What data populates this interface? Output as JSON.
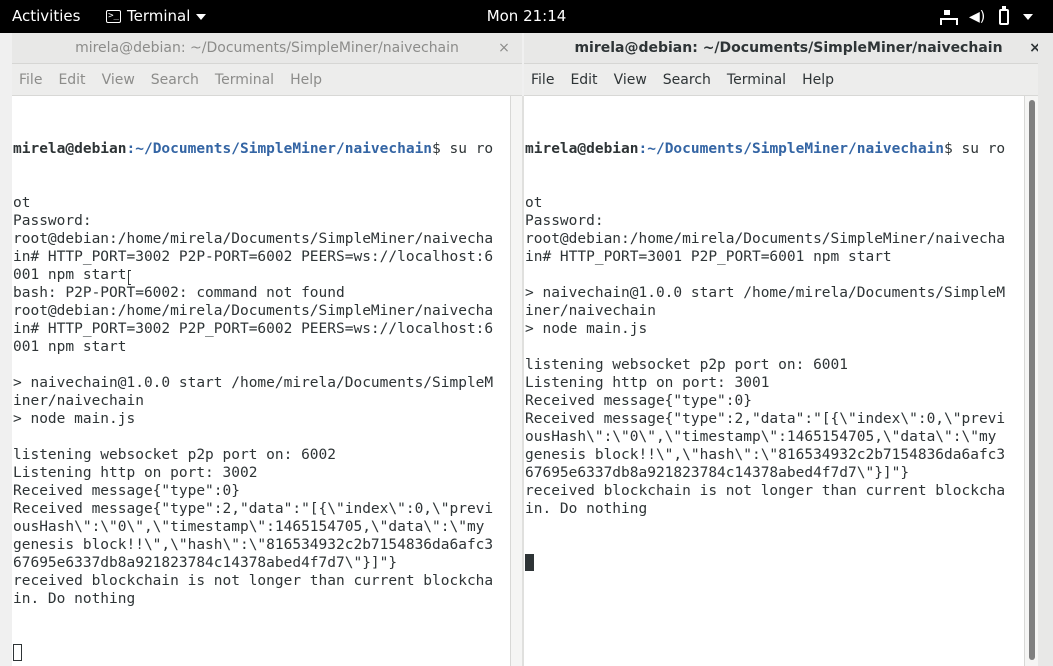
{
  "topbar": {
    "activities": "Activities",
    "app_name": "Terminal",
    "clock": "Mon 21:14",
    "icons": [
      "network-icon",
      "volume-icon",
      "battery-icon",
      "system-menu-caret-icon"
    ]
  },
  "left_window": {
    "title": "mirela@debian: ~/Documents/SimpleMiner/naivechain",
    "close": "×",
    "menu": [
      "File",
      "Edit",
      "View",
      "Search",
      "Terminal",
      "Help"
    ],
    "prompt_user": "mirela@debian",
    "prompt_path": ":~/Documents/SimpleMiner/naivechain",
    "first_cmd": "$ su ro",
    "lines": [
      "ot",
      "Password:",
      "root@debian:/home/mirela/Documents/SimpleMiner/naivecha",
      "in# HTTP_PORT=3002 P2P-PORT=6002 PEERS=ws://localhost:6",
      "001 npm start",
      "bash: P2P-PORT=6002: command not found",
      "root@debian:/home/mirela/Documents/SimpleMiner/naivecha",
      "in# HTTP_PORT=3002 P2P_PORT=6002 PEERS=ws://localhost:6",
      "001 npm start",
      "",
      "> naivechain@1.0.0 start /home/mirela/Documents/SimpleM",
      "iner/naivechain",
      "> node main.js",
      "",
      "listening websocket p2p port on: 6002",
      "Listening http on port: 3002",
      "Received message{\"type\":0}",
      "Received message{\"type\":2,\"data\":\"[{\\\"index\\\":0,\\\"previ",
      "ousHash\\\":\\\"0\\\",\\\"timestamp\\\":1465154705,\\\"data\\\":\\\"my",
      "genesis block!!\\\",\\\"hash\\\":\\\"816534932c2b7154836da6afc3",
      "67695e6337db8a921823784c14378abed4f7d7\\\"}]\"}",
      "received blockchain is not longer than current blockcha",
      "in. Do nothing"
    ]
  },
  "right_window": {
    "title": "mirela@debian: ~/Documents/SimpleMiner/naivechain",
    "close": "×",
    "menu": [
      "File",
      "Edit",
      "View",
      "Search",
      "Terminal",
      "Help"
    ],
    "prompt_user": "mirela@debian",
    "prompt_path": ":~/Documents/SimpleMiner/naivechain",
    "first_cmd": "$ su ro",
    "lines": [
      "ot",
      "Password:",
      "root@debian:/home/mirela/Documents/SimpleMiner/naivecha",
      "in# HTTP_PORT=3001 P2P_PORT=6001 npm start",
      "",
      "> naivechain@1.0.0 start /home/mirela/Documents/SimpleM",
      "iner/naivechain",
      "> node main.js",
      "",
      "listening websocket p2p port on: 6001",
      "Listening http on port: 3001",
      "Received message{\"type\":0}",
      "Received message{\"type\":2,\"data\":\"[{\\\"index\\\":0,\\\"previ",
      "ousHash\\\":\\\"0\\\",\\\"timestamp\\\":1465154705,\\\"data\\\":\\\"my",
      "genesis block!!\\\",\\\"hash\\\":\\\"816534932c2b7154836da6afc3",
      "67695e6337db8a921823784c14378abed4f7d7\\\"}]\"}",
      "received blockchain is not longer than current blockcha",
      "in. Do nothing"
    ]
  }
}
